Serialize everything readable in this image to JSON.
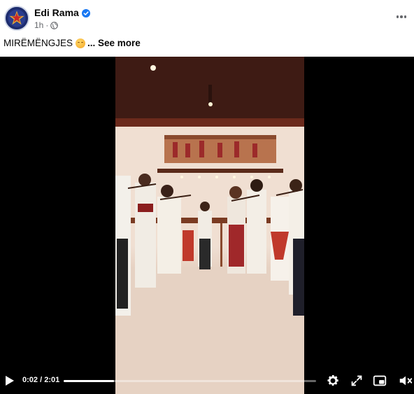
{
  "post": {
    "author": "Edi Rama",
    "time": "1h",
    "caption_text": "MIRËMËNGJES",
    "see_more_label": "... See more"
  },
  "video": {
    "current_time": "0:02",
    "separator": " / ",
    "duration": "2:01",
    "progress_fraction": 0.2
  },
  "icons": {
    "verified": "verified-badge-icon",
    "audience": "globe-icon",
    "more": "more-options-icon",
    "play": "play-icon",
    "settings": "gear-icon",
    "fullscreen": "expand-icon",
    "pip": "picture-in-picture-icon",
    "volume": "volume-muted-icon"
  },
  "colors": {
    "verified": "#1877f2",
    "secondary_text": "#65676b",
    "video_bg": "#000000"
  }
}
